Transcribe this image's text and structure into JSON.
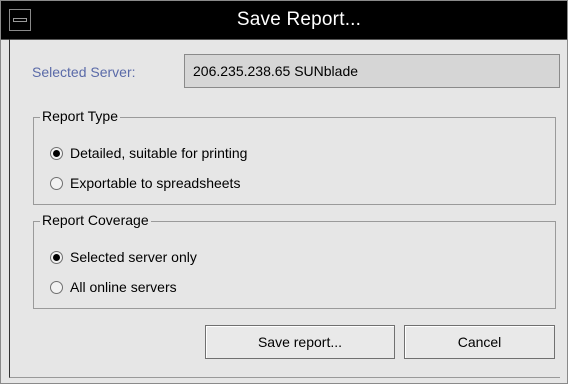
{
  "window": {
    "title": "Save Report..."
  },
  "server": {
    "label": "Selected Server:",
    "value": "206.235.238.65 SUNblade"
  },
  "report_type": {
    "title": "Report Type",
    "options": [
      {
        "label": "Detailed, suitable for printing",
        "selected": true
      },
      {
        "label": "Exportable to spreadsheets",
        "selected": false
      }
    ]
  },
  "report_coverage": {
    "title": "Report Coverage",
    "options": [
      {
        "label": "Selected server only",
        "selected": true
      },
      {
        "label": "All online servers",
        "selected": false
      }
    ]
  },
  "buttons": {
    "save": "Save report...",
    "cancel": "Cancel"
  },
  "colors": {
    "title_bar": "#000000",
    "title_text": "#ffffff",
    "label_accent": "#5a6aa8",
    "dialog_bg": "#e6e6e6"
  }
}
